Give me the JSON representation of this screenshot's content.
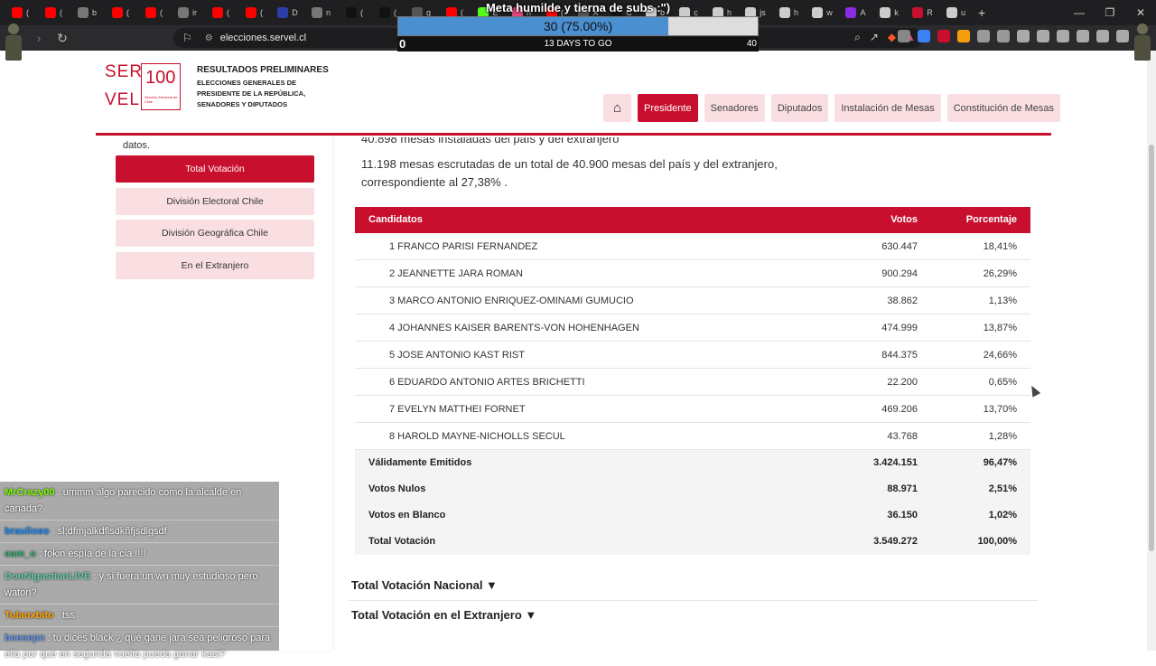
{
  "browser": {
    "tabs": [
      {
        "label": "(",
        "color": "#ff0000"
      },
      {
        "label": "(",
        "color": "#ff0000"
      },
      {
        "label": "b",
        "color": "#777777"
      },
      {
        "label": "(",
        "color": "#ff0000"
      },
      {
        "label": "(",
        "color": "#ff0000"
      },
      {
        "label": "ir",
        "color": "#777777"
      },
      {
        "label": "(",
        "color": "#ff0000"
      },
      {
        "label": "(",
        "color": "#ff0000"
      },
      {
        "label": "D",
        "color": "#2b3fa8"
      },
      {
        "label": "n",
        "color": "#777777"
      },
      {
        "label": "(",
        "color": "#111111"
      },
      {
        "label": "(",
        "color": "#111111"
      },
      {
        "label": "g",
        "color": "#555555"
      },
      {
        "label": "(",
        "color": "#ff0000"
      },
      {
        "label": "E",
        "color": "#53fc18"
      },
      {
        "label": "h",
        "color": "#e0457b"
      },
      {
        "label": "(",
        "color": "#ff0000"
      },
      {
        "label": "X",
        "color": "#555555"
      },
      {
        "label": "C",
        "color": "#111111"
      },
      {
        "label": "b",
        "color": "#cccccc"
      },
      {
        "label": "c",
        "color": "#cccccc"
      },
      {
        "label": "h",
        "color": "#cccccc"
      },
      {
        "label": "js",
        "color": "#cccccc"
      },
      {
        "label": "h",
        "color": "#cccccc"
      },
      {
        "label": "w",
        "color": "#cccccc"
      },
      {
        "label": "A",
        "color": "#8a2be2"
      },
      {
        "label": "k",
        "color": "#cccccc"
      },
      {
        "label": "R",
        "color": "#c8102e"
      },
      {
        "label": "u",
        "color": "#cccccc"
      }
    ],
    "url": "elecciones.servel.cl"
  },
  "overlay": {
    "goal_title": "Meta humilde y tierna de subs :\")",
    "goal_count": "30 (75.00%)",
    "goal_progress": 0.75,
    "goal_days": "13 DAYS TO GO",
    "goal_min": "0",
    "goal_max": "40"
  },
  "header": {
    "logo_top": "SER",
    "logo_bottom": "VEL",
    "logo_number": "100",
    "logo_small": "Servicio Electoral de Chile",
    "title": "RESULTADOS PRELIMINARES",
    "subtitle": "ELECCIONES GENERALES DE PRESIDENTE DE LA REPÚBLICA, SENADORES Y DIPUTADOS",
    "nav": [
      "Presidente",
      "Senadores",
      "Diputados",
      "Instalación de Mesas",
      "Constitución de Mesas"
    ]
  },
  "sidebar": {
    "top_text": "datos.",
    "buttons": [
      "Total Votación",
      "División Electoral Chile",
      "División Geográfica Chile",
      "En el Extranjero"
    ]
  },
  "content": {
    "line0": "40.898 mesas instaladas del país y del extranjero",
    "line1": "11.198 mesas escrutadas de un total de 40.900 mesas del país y del extranjero,",
    "line2": "correspondiente al 27,38% .",
    "table": {
      "headers": {
        "name": "Candidatos",
        "votes": "Votos",
        "pct": "Porcentaje"
      },
      "rows": [
        {
          "name": "1 FRANCO PARISI FERNANDEZ",
          "votes": "630.447",
          "pct": "18,41%"
        },
        {
          "name": "2 JEANNETTE JARA ROMAN",
          "votes": "900.294",
          "pct": "26,29%"
        },
        {
          "name": "3 MARCO ANTONIO ENRIQUEZ-OMINAMI GUMUCIO",
          "votes": "38.862",
          "pct": "1,13%"
        },
        {
          "name": "4 JOHANNES KAISER BARENTS-VON HOHENHAGEN",
          "votes": "474.999",
          "pct": "13,87%"
        },
        {
          "name": "5 JOSE ANTONIO KAST RIST",
          "votes": "844.375",
          "pct": "24,66%"
        },
        {
          "name": "6 EDUARDO ANTONIO ARTES BRICHETTI",
          "votes": "22.200",
          "pct": "0,65%"
        },
        {
          "name": "7 EVELYN MATTHEI FORNET",
          "votes": "469.206",
          "pct": "13,70%"
        },
        {
          "name": "8 HAROLD MAYNE-NICHOLLS SECUL",
          "votes": "43.768",
          "pct": "1,28%"
        }
      ],
      "totals": [
        {
          "name": "Válidamente Emitidos",
          "votes": "3.424.151",
          "pct": "96,47%"
        },
        {
          "name": "Votos Nulos",
          "votes": "88.971",
          "pct": "2,51%"
        },
        {
          "name": "Votos en Blanco",
          "votes": "36.150",
          "pct": "1,02%"
        },
        {
          "name": "Total Votación",
          "votes": "3.549.272",
          "pct": "100,00%"
        }
      ]
    },
    "section1": "Total Votación Nacional ▼",
    "section2": "Total Votación en el Extranjero ▼"
  },
  "chat": [
    {
      "user": "MrCrazy00",
      "color": "#7cfc00",
      "text": " : ummm algo parecido como la alcalde en canada?"
    },
    {
      "user": "braulioeo",
      "color": "#1e90ff",
      "text": " : sl;dfmjalkdflsdkñfjsdlgsdf"
    },
    {
      "user": "eam_o",
      "color": "#3cb371",
      "text": " : fokin espía de la cia !!!!"
    },
    {
      "user": "DonNigastianLIVE",
      "color": "#66cdaa",
      "text": " : y si fuera un wn muy estudioso pero waton?"
    },
    {
      "user": "Tulanxbito",
      "color": "#ffa500",
      "text": " : tss"
    },
    {
      "user": "beesepn",
      "color": "#6495ed",
      "text": " : tu dices black ¿ qué gane jara sea peligroso para ella por que en segunda vuelta pueda ganar kast?"
    }
  ]
}
